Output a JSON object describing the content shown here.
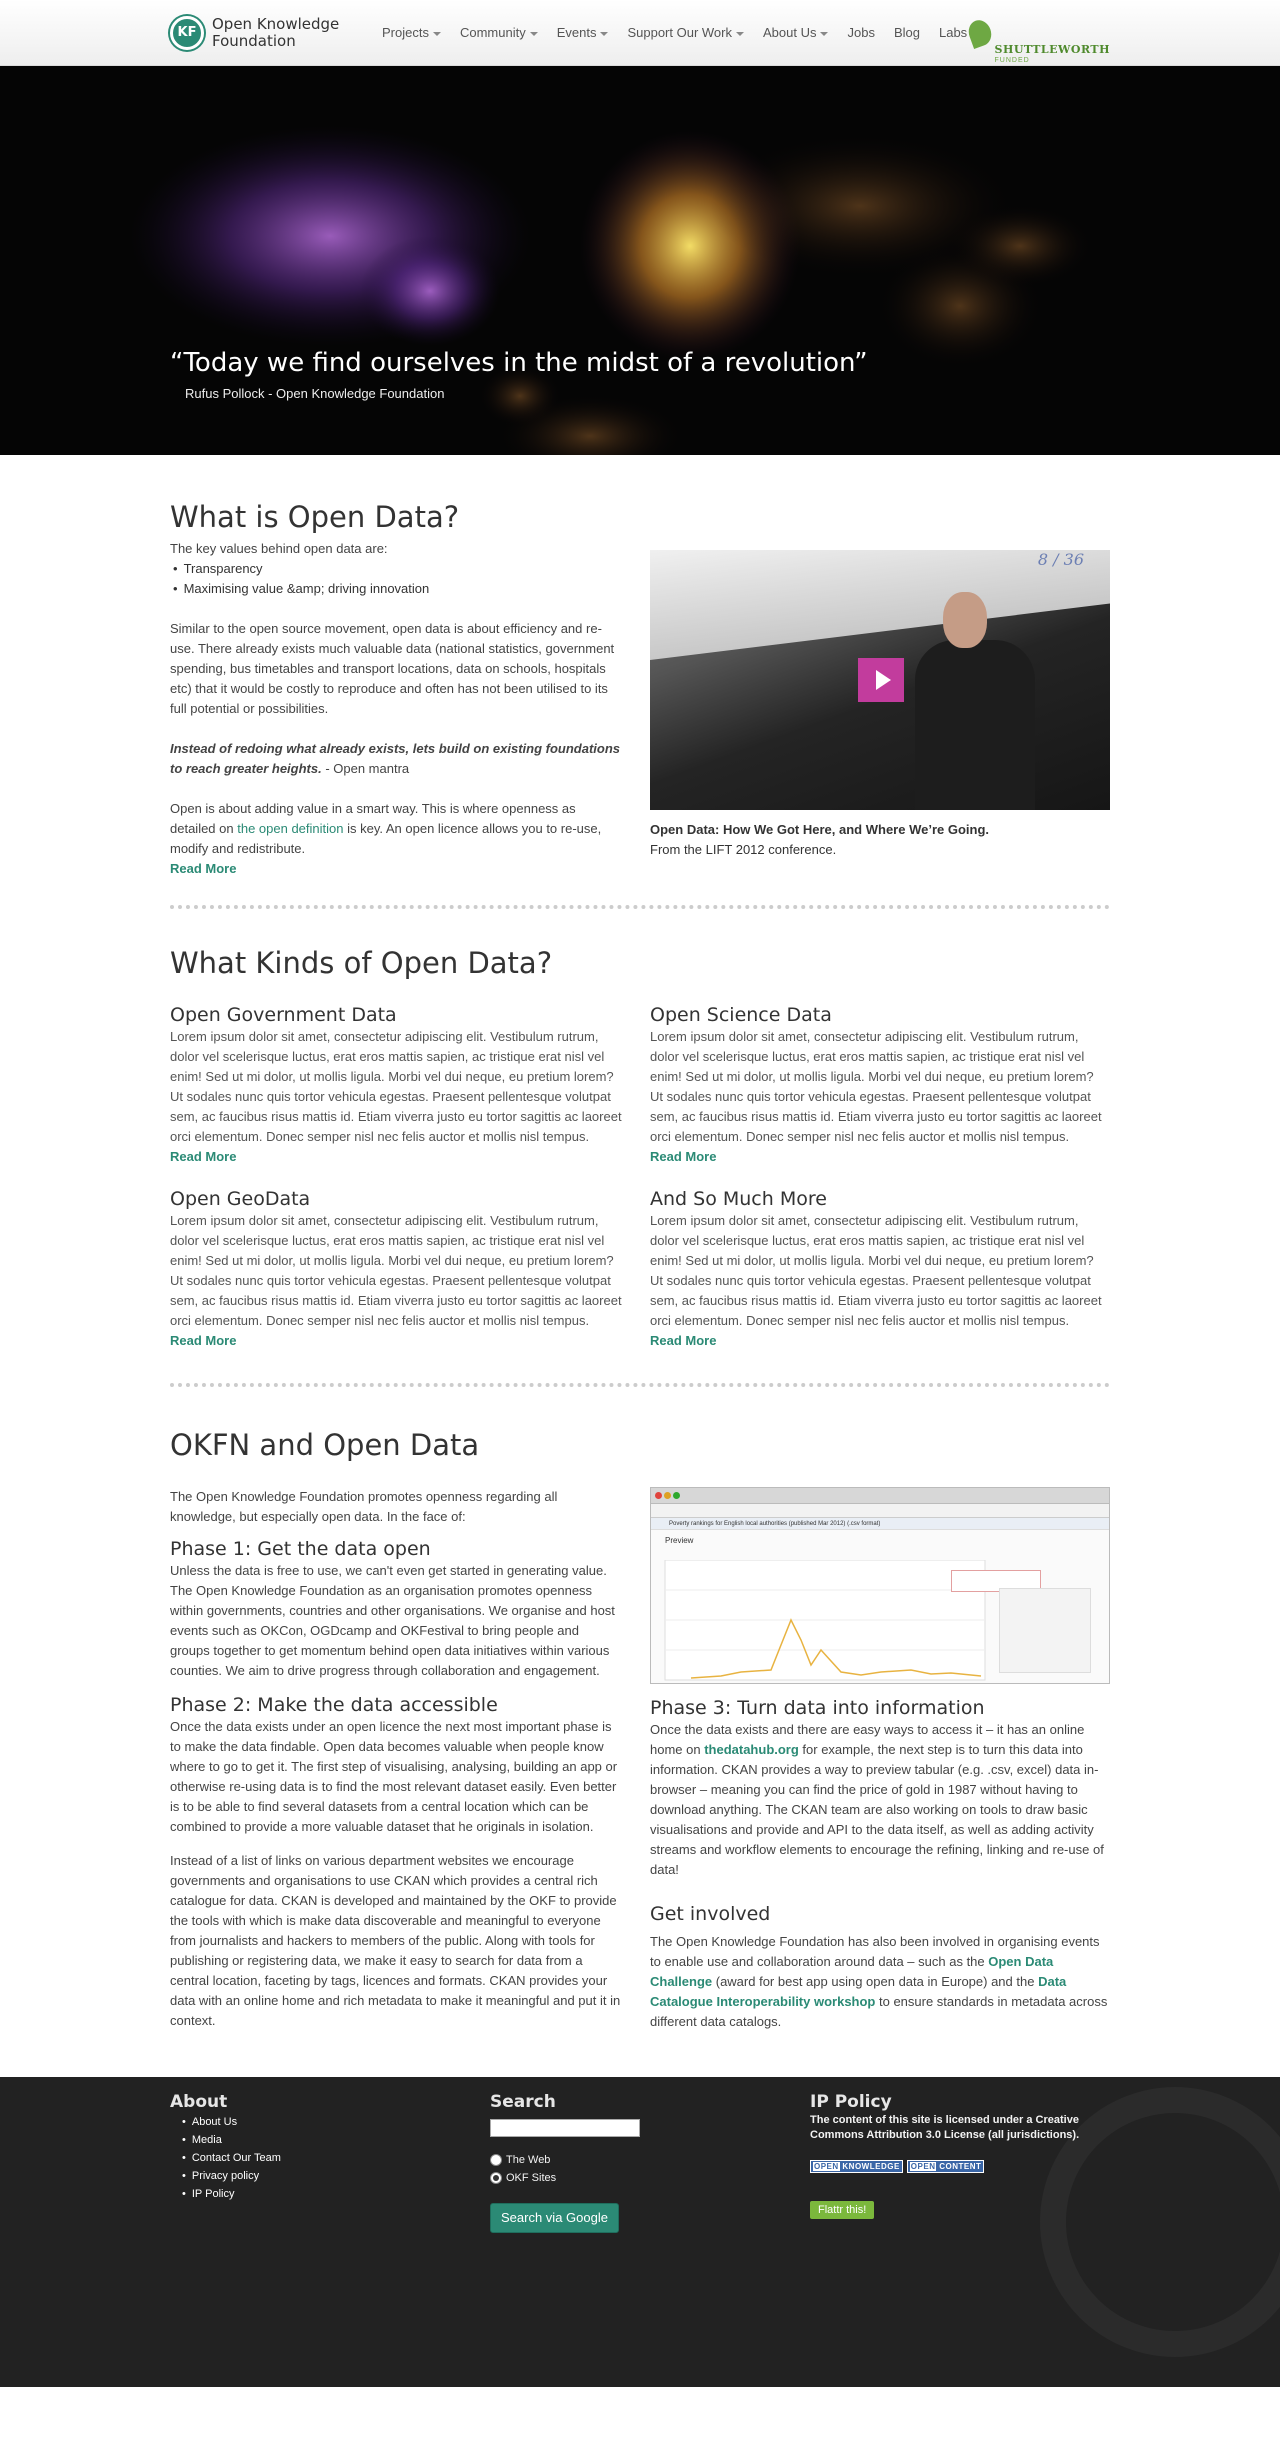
{
  "header": {
    "logo_line1": "Open Knowledge",
    "logo_line2": "Foundation",
    "logo_mark": "KF",
    "nav": [
      {
        "label": "Projects",
        "dropdown": true
      },
      {
        "label": "Community",
        "dropdown": true
      },
      {
        "label": "Events",
        "dropdown": true
      },
      {
        "label": "Support Our Work",
        "dropdown": true
      },
      {
        "label": "About Us",
        "dropdown": true
      },
      {
        "label": "Jobs",
        "dropdown": false
      },
      {
        "label": "Blog",
        "dropdown": false
      },
      {
        "label": "Labs",
        "dropdown": false
      }
    ],
    "sponsor_line1": "SHUTTLEWORTH",
    "sponsor_line2": "FUNDED"
  },
  "hero": {
    "quote": "“Today we find ourselves in the midst of a revolution”",
    "attribution": "Rufus Pollock - Open Knowledge Foundation"
  },
  "what_is": {
    "title": "What is Open Data?",
    "intro": "The key values behind open data are:",
    "values": [
      "Transparency",
      "Maximising value &amp; driving innovation"
    ],
    "para1": "Similar to the open source movement, open data is about efficiency and re-use. There already exists much valuable data (national statistics, government spending, bus timetables and transport locations, data on schools, hospitals etc) that it would be costly to reproduce and often has not been utilised to its full potential or possibilities.",
    "mantra": "Instead of redoing what already exists, lets build on existing foundations to reach greater heights.",
    "mantra_source": " - Open mantra",
    "para3_a": "Open is about adding value in a smart way. This is where openness as detailed on ",
    "para3_link": "the open definition",
    "para3_b": " is key. An open licence allows you to re-use, modify and redistribute.",
    "read_more": "Read More",
    "video_slide": "8 / 36",
    "video_title": "Open Data: How We Got Here, and Where We’re Going.",
    "video_sub": "From the LIFT 2012 conference."
  },
  "kinds": {
    "title": "What Kinds of Open Data?",
    "items": [
      {
        "title": "Open Government Data",
        "text": "Lorem ipsum dolor sit amet, consectetur adipiscing elit. Vestibulum rutrum, dolor vel scelerisque luctus, erat eros mattis sapien, ac tristique erat nisl vel enim! Sed ut mi dolor, ut mollis ligula. Morbi vel dui neque, eu pretium lorem? Ut sodales nunc quis tortor vehicula egestas. Praesent pellentesque volutpat sem, ac faucibus risus mattis id. Etiam viverra justo eu tortor sagittis ac laoreet orci elementum. Donec semper nisl nec felis auctor et mollis nisl tempus.",
        "link": "Read More"
      },
      {
        "title": "Open Science Data",
        "text": "Lorem ipsum dolor sit amet, consectetur adipiscing elit. Vestibulum rutrum, dolor vel scelerisque luctus, erat eros mattis sapien, ac tristique erat nisl vel enim! Sed ut mi dolor, ut mollis ligula. Morbi vel dui neque, eu pretium lorem? Ut sodales nunc quis tortor vehicula egestas. Praesent pellentesque volutpat sem, ac faucibus risus mattis id. Etiam viverra justo eu tortor sagittis ac laoreet orci elementum. Donec semper nisl nec felis auctor et mollis nisl tempus.",
        "link": "Read More"
      },
      {
        "title": "Open GeoData",
        "text": "Lorem ipsum dolor sit amet, consectetur adipiscing elit. Vestibulum rutrum, dolor vel scelerisque luctus, erat eros mattis sapien, ac tristique erat nisl vel enim! Sed ut mi dolor, ut mollis ligula. Morbi vel dui neque, eu pretium lorem? Ut sodales nunc quis tortor vehicula egestas. Praesent pellentesque volutpat sem, ac faucibus risus mattis id. Etiam viverra justo eu tortor sagittis ac laoreet orci elementum. Donec semper nisl nec felis auctor et mollis nisl tempus.",
        "link": "Read More"
      },
      {
        "title": "And So Much More",
        "text": "Lorem ipsum dolor sit amet, consectetur adipiscing elit. Vestibulum rutrum, dolor vel scelerisque luctus, erat eros mattis sapien, ac tristique erat nisl vel enim! Sed ut mi dolor, ut mollis ligula. Morbi vel dui neque, eu pretium lorem? Ut sodales nunc quis tortor vehicula egestas. Praesent pellentesque volutpat sem, ac faucibus risus mattis id. Etiam viverra justo eu tortor sagittis ac laoreet orci elementum. Donec semper nisl nec felis auctor et mollis nisl tempus.",
        "link": "Read More"
      }
    ]
  },
  "okfn": {
    "title": "OKFN and Open Data",
    "intro": "The Open Knowledge Foundation promotes openness regarding all knowledge, but especially open data. In the face of:",
    "phase1_title": "Phase 1: Get the data open",
    "phase1_text": "Unless the data is free to use, we can't even get started in generating value. The Open Knowledge Foundation as an organisation promotes openness within governments, countries and other organisations. We organise and host events such as OKCon, OGDcamp and OKFestival to bring people and groups together to get momentum behind open data initiatives within various counties. We aim to drive progress through collaboration and engagement.",
    "phase2_title": "Phase 2: Make the data accessible",
    "phase2_text": "Once the data exists under an open licence the next most important phase is to make the data findable. Open data becomes valuable when people know where to go to get it. The first step of visualising, analysing, building an app or otherwise re-using data is to find the most relevant dataset easily. Even better is to be able to find several datasets from a central location which can be combined to provide a more valuable dataset that he originals in isolation.",
    "phase2_text2": "Instead of a list of links on various department websites we encourage governments and organisations to use CKAN which provides a central rich catalogue for data. CKAN is developed and maintained by the OKF to provide the tools with which is make data discoverable and meaningful to everyone from journalists and hackers to members of the public. Along with tools for publishing or registering data, we make it easy to search for data from a central location, faceting by tags, licences and formats. CKAN provides your data with an online home and rich metadata to make it meaningful and put it in context.",
    "shot_title": "Poverty rankings for English local authorities (published Mar 2012) (.csv format)",
    "shot_preview": "Preview",
    "phase3_title": "Phase 3: Turn data into information",
    "phase3_a": "Once the data exists and there are easy ways to access it – it has an online home on ",
    "phase3_link": "thedatahub.org",
    "phase3_b": " for example, the next step is to turn this data into information. CKAN provides a way to preview tabular (e.g. .csv, excel) data in-browser – meaning you can find the price of gold in 1987 without having to download anything. The CKAN team are also working on tools to draw basic visualisations and provide and API to the data itself, as well as adding activity streams and workflow elements to encourage the refining, linking and re-use of data!",
    "get_involved_title": "Get involved",
    "gi_a": "The Open Knowledge Foundation has also been involved in organising events to enable use and collaboration around data – such as the ",
    "gi_link1": "Open Data Challenge",
    "gi_b": " (award for best app using open data in Europe) and the ",
    "gi_link2": "Data Catalogue Interoperability workshop",
    "gi_c": " to ensure standards in metadata across different data catalogs."
  },
  "footer": {
    "about_title": "About",
    "about_links": [
      "About Us",
      "Media",
      "Contact Our Team",
      "Privacy policy",
      "IP Policy"
    ],
    "search_title": "Search",
    "search_value": "",
    "radio_web": "The Web",
    "radio_okf": "OKF Sites",
    "search_button": "Search via Google",
    "ip_title": "IP Policy",
    "ip_text": "The content of this site is licensed under a Creative Commons Attribution 3.0 License (all jurisdictions).",
    "badge1_a": "OPEN",
    "badge1_b": "KNOWLEDGE",
    "badge2_a": "OPEN",
    "badge2_b": "CONTENT",
    "flattr": "Flattr this!"
  },
  "colors": {
    "accent": "#2b8a75",
    "footer_bg": "#222222",
    "play": "#c23c9d"
  }
}
